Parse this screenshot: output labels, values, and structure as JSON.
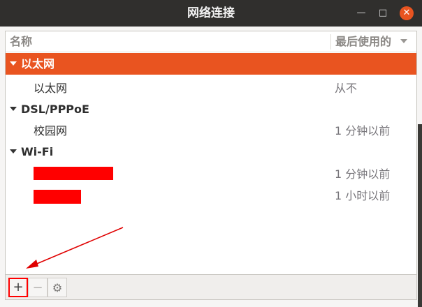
{
  "window": {
    "title": "网络连接"
  },
  "columns": {
    "name": "名称",
    "last_used": "最后使用的"
  },
  "rows": [
    {
      "kind": "group",
      "label": "以太网",
      "selected": true
    },
    {
      "kind": "conn",
      "label": "以太网",
      "time": "从不"
    },
    {
      "kind": "group",
      "label": "DSL/PPPoE"
    },
    {
      "kind": "conn",
      "label": "校园网",
      "time": "1 分钟以前"
    },
    {
      "kind": "group",
      "label": "Wi-Fi"
    },
    {
      "kind": "conn",
      "label": "",
      "time": "1 分钟以前",
      "redacted": true
    },
    {
      "kind": "conn",
      "label": "",
      "time": "1 小时以前",
      "redacted": true
    }
  ],
  "toolbar": {
    "add_icon": "+",
    "remove_icon": "−",
    "settings_icon": "⚙"
  },
  "colors": {
    "accent": "#e95420",
    "highlight": "#ff0000"
  }
}
